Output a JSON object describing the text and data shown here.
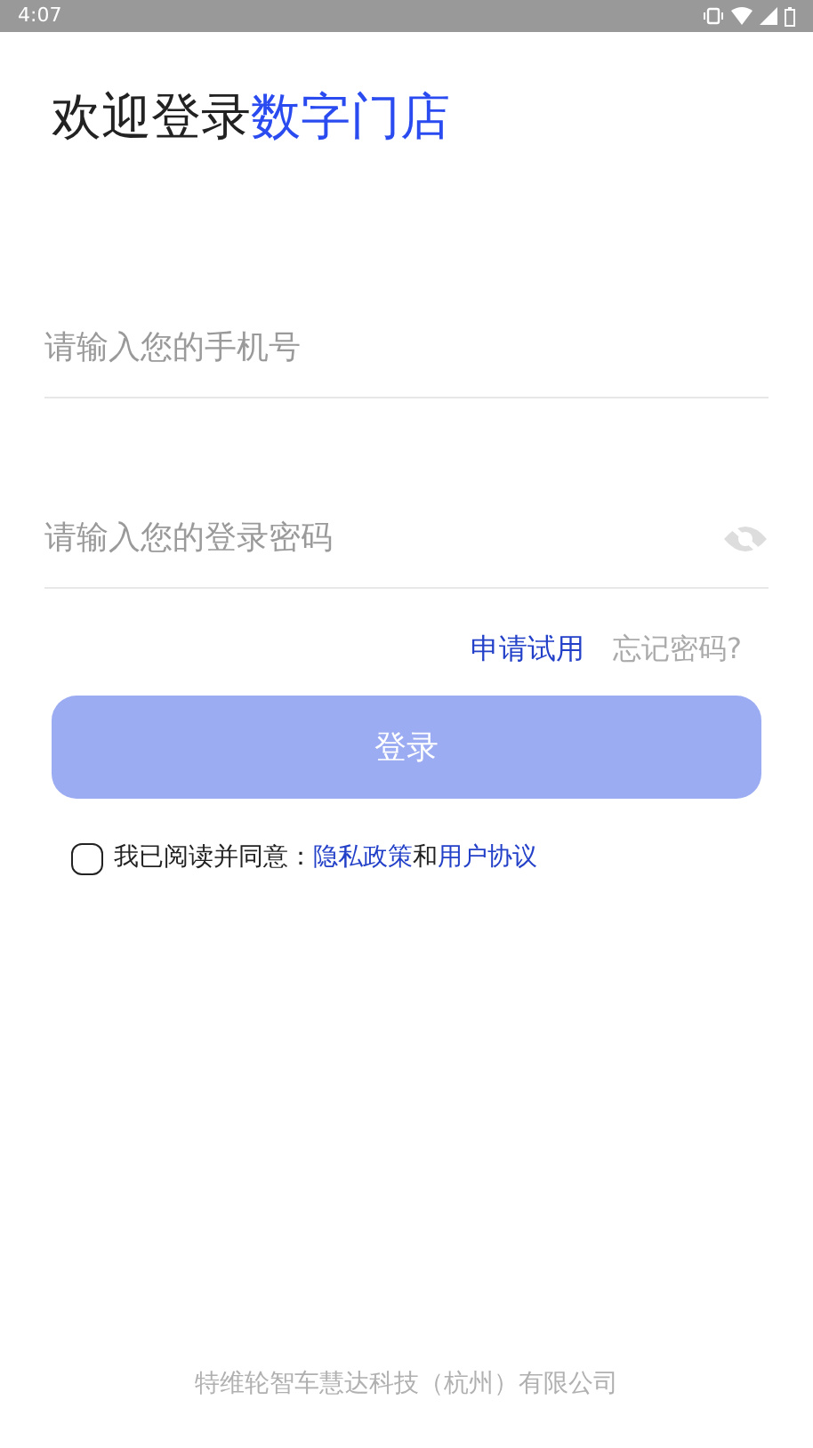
{
  "status_bar": {
    "time": "4:07"
  },
  "title": {
    "prefix": "欢迎登录",
    "highlight": "数字门店"
  },
  "phone_field": {
    "placeholder": "请输入您的手机号"
  },
  "password_field": {
    "placeholder": "请输入您的登录密码",
    "visible": false
  },
  "links": {
    "apply": "申请试用",
    "forgot": "忘记密码?"
  },
  "login_button": {
    "label": "登录",
    "disabled": true
  },
  "agreement": {
    "checked": false,
    "text": "我已阅读并同意：",
    "privacy": "隐私政策",
    "joiner": "和",
    "terms": "用户协议"
  },
  "footer": "特维轮智车慧达科技（杭州）有限公司"
}
